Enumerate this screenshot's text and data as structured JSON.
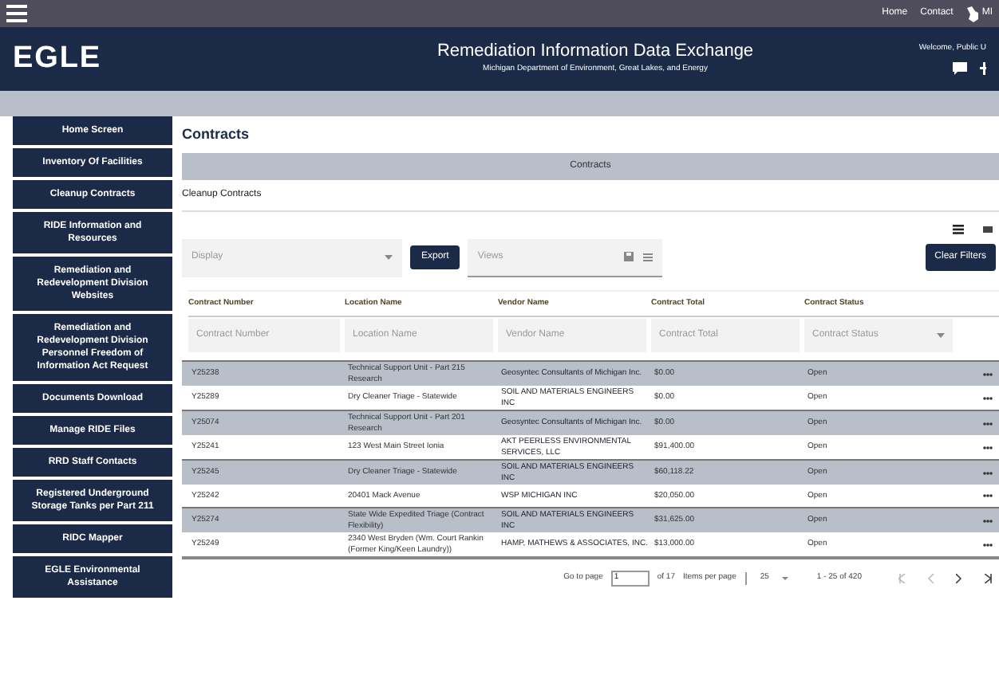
{
  "top_bar": {
    "links": [
      "Home",
      "Contact"
    ],
    "state_label": "MI"
  },
  "header": {
    "logo": "EGLE",
    "title": "Remediation Information Data Exchange",
    "subtitle": "Michigan Department of Environment, Great Lakes, and Energy",
    "welcome": "Welcome, Public U"
  },
  "sidebar": {
    "items": [
      {
        "label": "Home Screen"
      },
      {
        "label": "Inventory Of Facilities"
      },
      {
        "label": "Cleanup Contracts"
      },
      {
        "label": "RIDE Information and Resources"
      },
      {
        "label": "Remediation and Redevelopment Division Websites"
      },
      {
        "label": "Remediation and Redevelopment Division Personnel Freedom of Information Act Request"
      },
      {
        "label": "Documents Download"
      },
      {
        "label": "Manage RIDE Files"
      },
      {
        "label": "RRD Staff Contacts"
      },
      {
        "label": "Registered Underground Storage Tanks per Part 211"
      },
      {
        "label": "RIDC Mapper"
      },
      {
        "label": "EGLE Environmental Assistance"
      }
    ]
  },
  "page_title": "Contracts",
  "panel_title": "Contracts",
  "panel_subtitle": "Cleanup Contracts",
  "toolbar": {
    "display": {
      "placeholder": "Display"
    },
    "export_button": "Export",
    "views": {
      "placeholder": "Views"
    },
    "clear_button": "Clear Filters"
  },
  "table": {
    "columns": [
      "Contract Number",
      "Location Name",
      "Vendor Name",
      "Contract Total",
      "Contract Status"
    ],
    "filters": [
      {
        "placeholder": "Contract Number"
      },
      {
        "placeholder": "Location Name"
      },
      {
        "placeholder": "Vendor Name"
      },
      {
        "placeholder": "Contract Total"
      },
      {
        "placeholder": "Contract Status",
        "kind": "select"
      }
    ],
    "rows": [
      [
        "Y25238",
        "Technical Support Unit - Part 215 Research",
        "Geosyntec Consultants of Michigan Inc.",
        "$0.00",
        "Open"
      ],
      [
        "Y25289",
        "Dry Cleaner Triage - Statewide",
        "SOIL AND MATERIALS ENGINEERS INC",
        "$0.00",
        "Open"
      ],
      [
        "Y25074",
        "Technical Support Unit - Part 201 Research",
        "Geosyntec Consultants of Michigan Inc.",
        "$0.00",
        "Open"
      ],
      [
        "Y25241",
        "123 West Main Street Ionia",
        "AKT PEERLESS ENVIRONMENTAL SERVICES, LLC",
        "$91,400.00",
        "Open"
      ],
      [
        "Y25245",
        "Dry Cleaner Triage - Statewide",
        "SOIL AND MATERIALS ENGINEERS INC",
        "$60,118.22",
        "Open"
      ],
      [
        "Y25242",
        "20401 Mack Avenue",
        "WSP MICHIGAN INC",
        "$20,050.00",
        "Open"
      ],
      [
        "Y25274",
        "State Wide Expedited Triage (Contract Flexibility)",
        "SOIL AND MATERIALS ENGINEERS INC",
        "$31,625.00",
        "Open"
      ],
      [
        "Y25249",
        "2340 West Bryden (Wm. Court Rankin (Former King/Keen Laundry))",
        "HAMP, MATHEWS & ASSOCIATES, INC.",
        "$13,000.00",
        "Open"
      ]
    ]
  },
  "pagination": {
    "go_to_label": "Go to page",
    "page": "1",
    "of_label": "of 17",
    "items_label": "Items per page",
    "page_size": "25",
    "range": "1 - 25 of 420"
  }
}
